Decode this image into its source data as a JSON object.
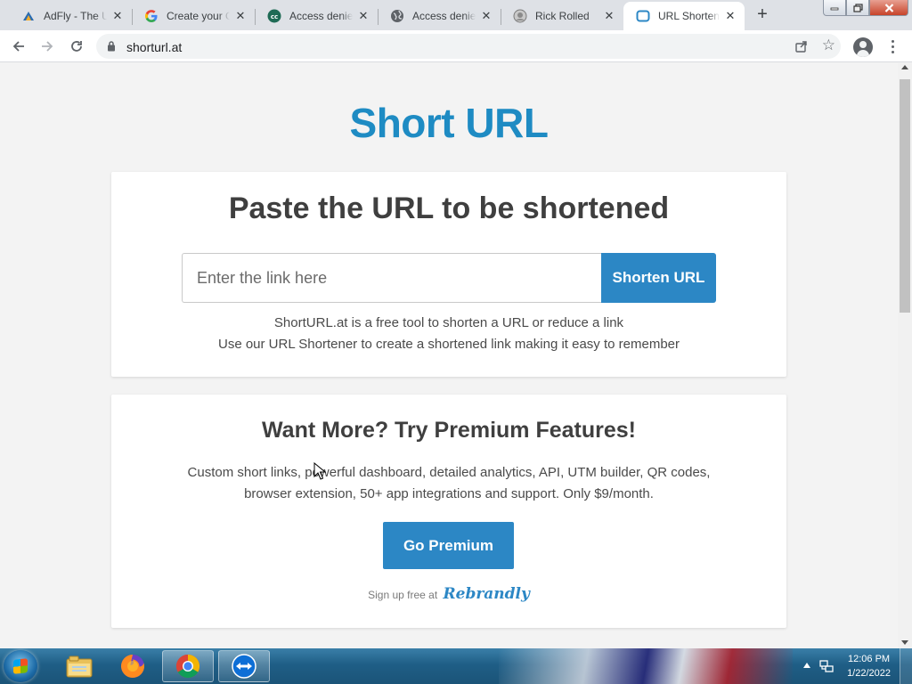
{
  "browser": {
    "tabs": [
      {
        "title": "AdFly - The U",
        "icon": "adfly-icon",
        "active": false
      },
      {
        "title": "Create your G",
        "icon": "google-icon",
        "active": false
      },
      {
        "title": "Access denied",
        "icon": "cc-icon",
        "active": false
      },
      {
        "title": "Access denied",
        "icon": "globe-icon",
        "active": false
      },
      {
        "title": "Rick Rolled",
        "icon": "rickroll-icon",
        "active": false
      },
      {
        "title": "URL Shortener",
        "icon": "shorturl-icon",
        "active": true
      }
    ],
    "new_tab_label": "+",
    "url": "shorturl.at"
  },
  "page": {
    "site_title": "Short URL",
    "main_card": {
      "heading": "Paste the URL to be shortened",
      "input_placeholder": "Enter the link here",
      "input_value": "",
      "button_label": "Shorten URL",
      "description_line1": "ShortURL.at is a free tool to shorten a URL or reduce a link",
      "description_line2": "Use our URL Shortener to create a shortened link making it easy to remember"
    },
    "premium_card": {
      "heading": "Want More? Try Premium Features!",
      "text_line1": "Custom short links, powerful dashboard, detailed analytics, API, UTM builder, QR codes,",
      "text_line2": "browser extension, 50+ app integrations and support. Only $9/month.",
      "button_label": "Go Premium",
      "signup_prefix": "Sign up free at",
      "signup_brand": "Rebrandly"
    },
    "accent_color": "#2c87c5",
    "title_color": "#1e8bc3"
  },
  "taskbar": {
    "time": "12:06 PM",
    "date": "1/22/2022",
    "pinned": [
      "windows-explorer-icon",
      "firefox-icon",
      "chrome-icon",
      "teamviewer-icon"
    ]
  }
}
